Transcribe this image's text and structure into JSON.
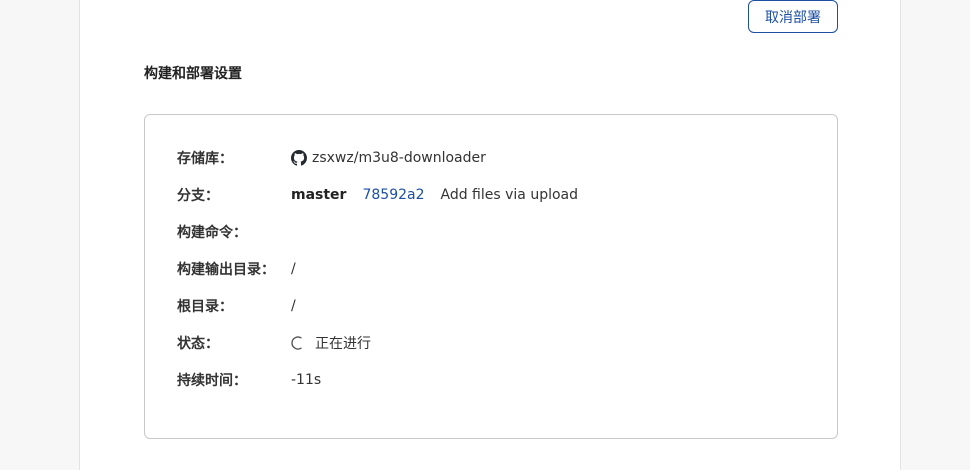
{
  "header": {
    "cancel_label": "取消部署"
  },
  "section": {
    "title": "构建和部署设置"
  },
  "details": {
    "repo_label": "存储库：",
    "repo_value": "zsxwz/m3u8-downloader",
    "branch_label": "分支：",
    "branch_name": "master",
    "commit_hash": "78592a2",
    "commit_message": "Add files via upload",
    "build_command_label": "构建命令：",
    "build_command_value": "",
    "output_dir_label": "构建输出目录：",
    "output_dir_value": "/",
    "root_dir_label": "根目录：",
    "root_dir_value": "/",
    "status_label": "状态：",
    "status_value": "正在进行",
    "duration_label": "持续时间：",
    "duration_value": "-11s"
  },
  "colors": {
    "accent": "#1d4fa3",
    "border": "#c9c9cc"
  },
  "icons": {
    "repo": "github-icon",
    "status": "spinner-icon"
  }
}
